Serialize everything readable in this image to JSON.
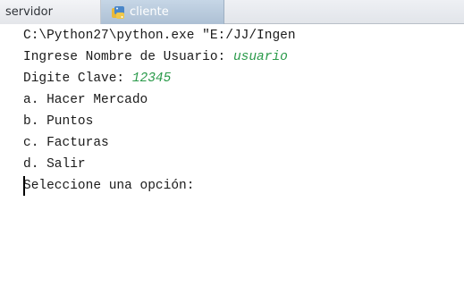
{
  "tabs": {
    "servidor_label": "servidor",
    "cliente_label": "cliente",
    "cliente_icon": "python-file-icon"
  },
  "console": {
    "command_line": "C:\\Python27\\python.exe \"E:/JJ/Ingen",
    "username_prompt": "Ingrese Nombre de Usuario: ",
    "username_value": "usuario",
    "password_prompt": "Digite Clave: ",
    "password_value": "12345",
    "menu_items": [
      "a. Hacer Mercado",
      "b. Puntos",
      "c. Facturas",
      "d. Salir"
    ],
    "selection_prompt": "Seleccione una opción:"
  },
  "colors": {
    "user_input": "#2a9a4a",
    "console_text": "#1a1a1a",
    "active_tab": "#adc0d4"
  }
}
